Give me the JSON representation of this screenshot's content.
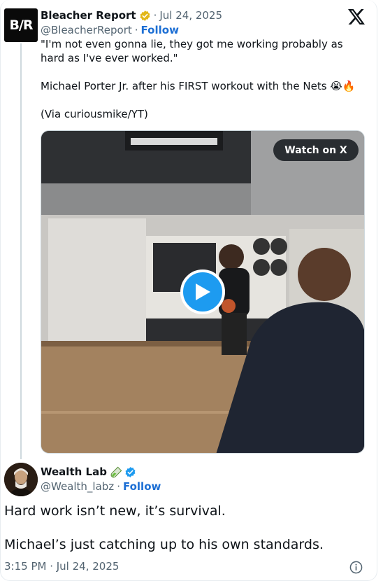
{
  "quoted": {
    "avatar_text": "B/R",
    "name": "Bleacher Report",
    "date": "Jul 24, 2025",
    "handle": "@BleacherReport",
    "follow": "Follow",
    "text_line1": "\"I'm not even gonna lie, they got me working probably as hard as I've ever worked.\"",
    "text_line2": "Michael Porter Jr. after his FIRST workout with the Nets 😭🔥",
    "text_line3": "(Via curiousmike/YT)",
    "media": {
      "watch_label": "Watch on X"
    }
  },
  "reply": {
    "name": "Wealth Lab",
    "handle": "@Wealth_labz",
    "follow": "Follow",
    "text_line1": "Hard work isn’t new, it’s survival.",
    "text_line2": "Michael’s just catching up to his own standards.",
    "timestamp": "3:15 PM · Jul 24, 2025"
  },
  "colors": {
    "verified_gold": "#e2b719",
    "verified_blue": "#1d9bf0",
    "link_blue": "#1d6fd4",
    "muted_text": "#536471"
  },
  "icons": {
    "x_logo": "x-logo-icon",
    "gold_badge": "verified-gold-icon",
    "blue_badge": "verified-blue-icon",
    "play": "play-icon",
    "info": "info-icon",
    "test_tube": "test-tube-icon"
  }
}
